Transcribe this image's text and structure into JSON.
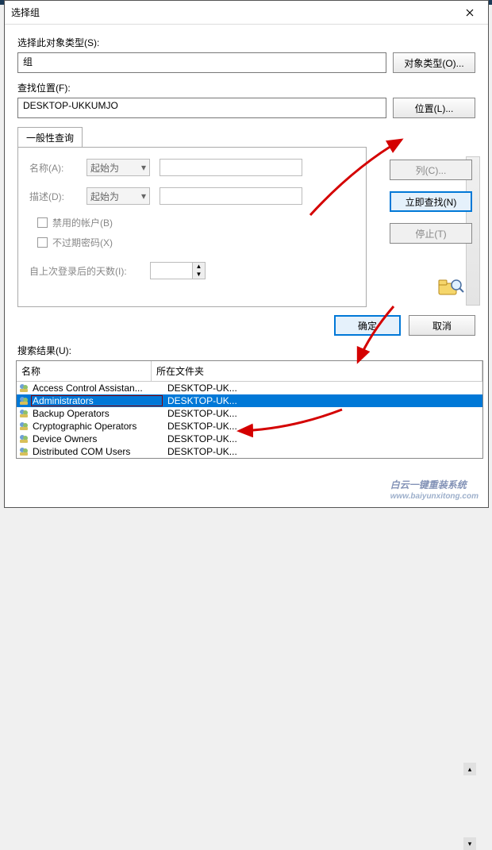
{
  "window": {
    "title": "选择组"
  },
  "objtype": {
    "label": "选择此对象类型(S):",
    "value": "组",
    "button": "对象类型(O)..."
  },
  "location": {
    "label": "查找位置(F):",
    "value": "DESKTOP-UKKUMJO",
    "button": "位置(L)..."
  },
  "tab": {
    "label": "一般性查询"
  },
  "query": {
    "name_lbl": "名称(A):",
    "name_mode": "起始为",
    "desc_lbl": "描述(D):",
    "desc_mode": "起始为",
    "chk_disabled": "禁用的帐户(B)",
    "chk_nopw": "不过期密码(X)",
    "days_lbl": "自上次登录后的天数(I):"
  },
  "side": {
    "columns": "列(C)...",
    "findnow": "立即查找(N)",
    "stop": "停止(T)"
  },
  "actions": {
    "ok": "确定",
    "cancel": "取消"
  },
  "results": {
    "label": "搜索结果(U):",
    "col_name": "名称",
    "col_folder": "所在文件夹",
    "rows": [
      {
        "name": "Access Control Assistan...",
        "folder": "DESKTOP-UK..."
      },
      {
        "name": "Administrators",
        "folder": "DESKTOP-UK..."
      },
      {
        "name": "Backup Operators",
        "folder": "DESKTOP-UK..."
      },
      {
        "name": "Cryptographic Operators",
        "folder": "DESKTOP-UK..."
      },
      {
        "name": "Device Owners",
        "folder": "DESKTOP-UK..."
      },
      {
        "name": "Distributed COM Users",
        "folder": "DESKTOP-UK..."
      }
    ],
    "selected_index": 1
  },
  "watermark": {
    "main": "白云一键重装系统",
    "sub": "www.baiyunxitong.com"
  }
}
